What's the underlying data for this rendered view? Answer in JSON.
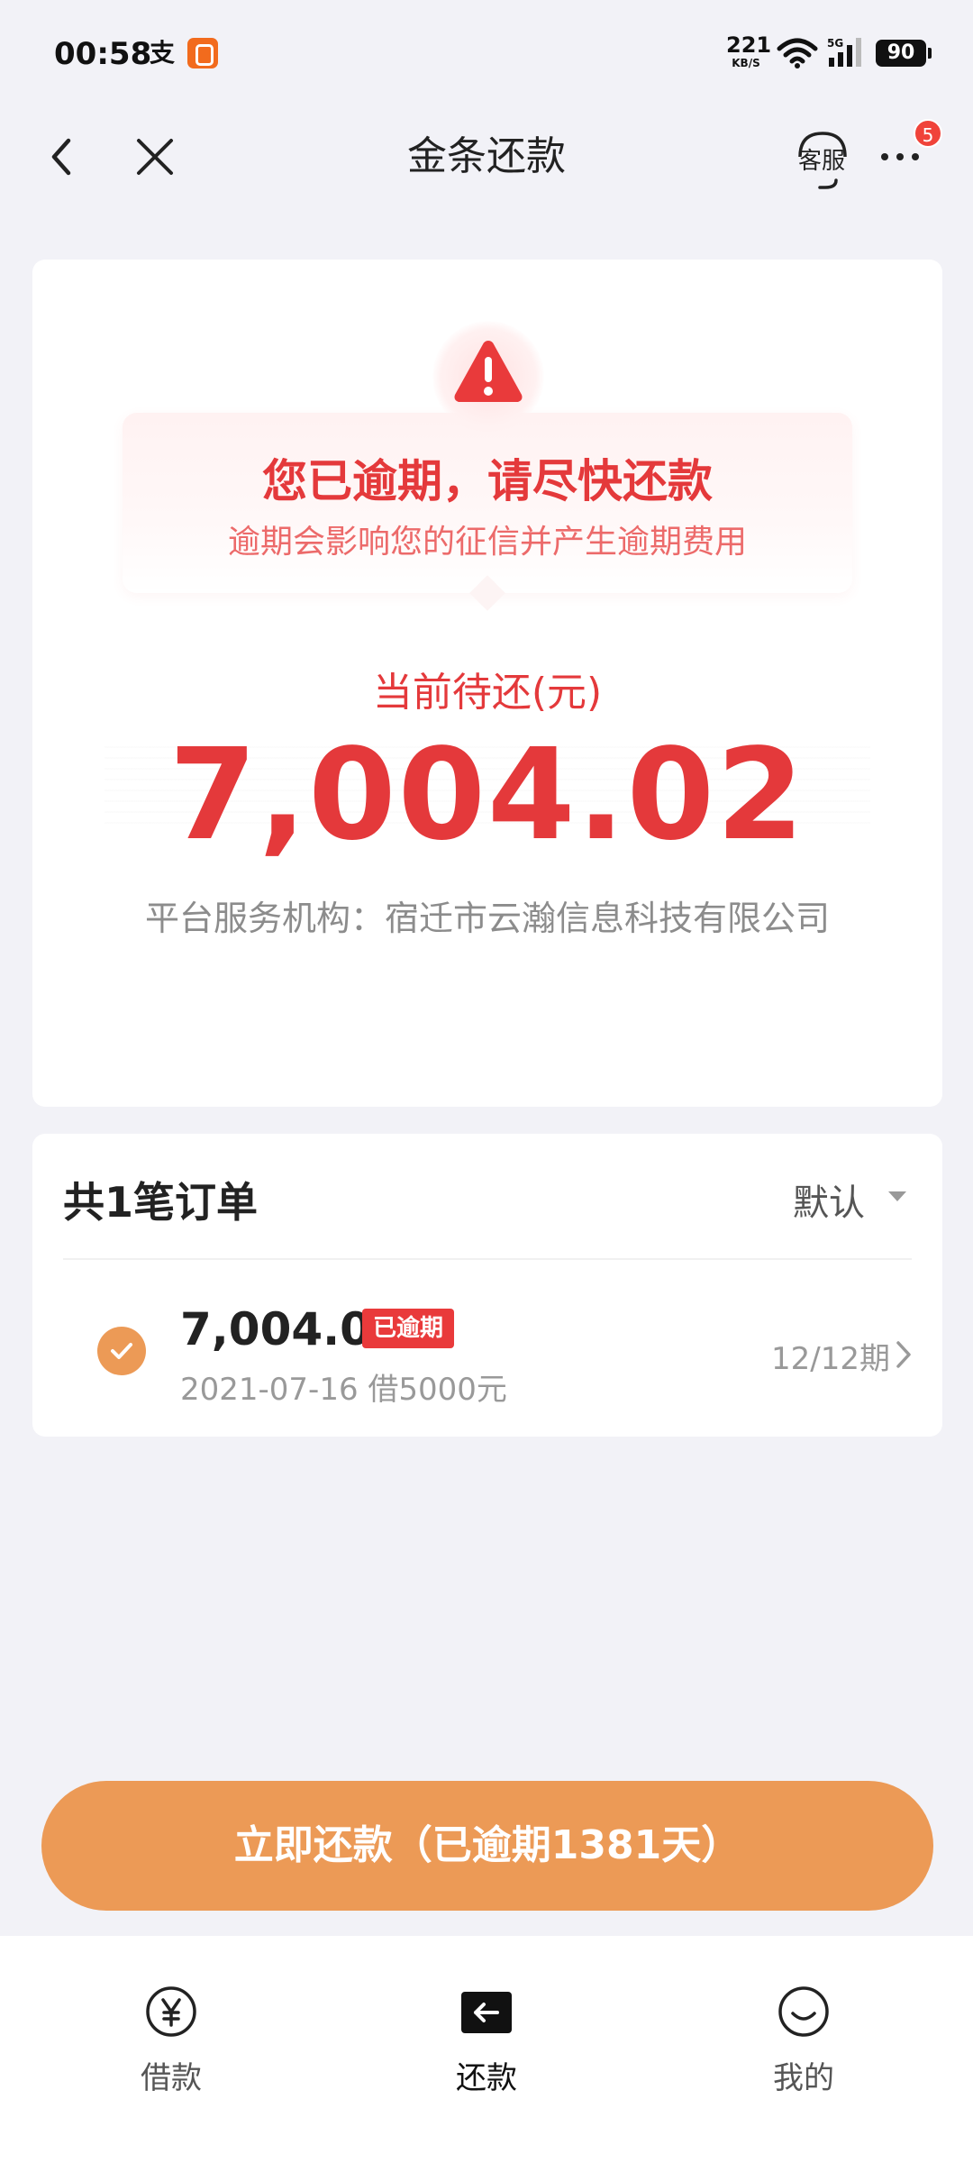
{
  "status_bar": {
    "time": "00:58",
    "app_icon_1": "支",
    "net_speed_value": "221",
    "net_speed_unit": "KB/S",
    "battery": "90"
  },
  "nav": {
    "title": "金条还款",
    "service_label": "客服",
    "more_badge": "5"
  },
  "warning": {
    "title": "您已逾期，请尽快还款",
    "subtitle": "逾期会影响您的征信并产生逾期费用"
  },
  "due": {
    "label": "当前待还(元)",
    "amount": "7,004.02",
    "platform": "平台服务机构：宿迁市云瀚信息科技有限公司"
  },
  "orders": {
    "title": "共1笔订单",
    "sort_label": "默认",
    "items": [
      {
        "amount": "7,004.02",
        "status_badge": "已逾期",
        "meta": "2021-07-16 借5000元",
        "period": "12/12期",
        "checked": true
      }
    ]
  },
  "pay_button": {
    "label": "立即还款（已逾期1381天）"
  },
  "tab_bar": {
    "items": [
      {
        "label": "借款",
        "icon": "yen-icon",
        "active": false
      },
      {
        "label": "还款",
        "icon": "repay-arrow-icon",
        "active": true
      },
      {
        "label": "我的",
        "icon": "smile-icon",
        "active": false
      }
    ]
  },
  "colors": {
    "accent_orange": "#ec9a56",
    "alert_red": "#e4393b",
    "background": "#f2f2f7"
  }
}
